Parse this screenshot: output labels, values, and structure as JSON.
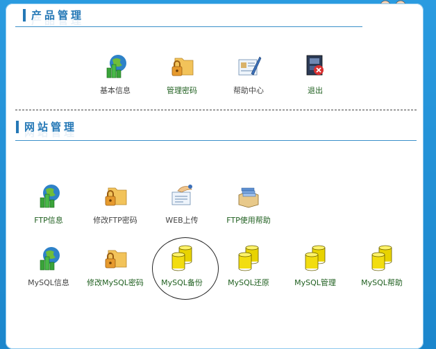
{
  "product_section": {
    "title": "产品管理",
    "items": [
      {
        "label": "基本信息",
        "icon": "globe-chart-icon",
        "style": "gray"
      },
      {
        "label": "管理密码",
        "icon": "folder-lock-icon",
        "style": "green"
      },
      {
        "label": "帮助中心",
        "icon": "help-card-icon",
        "style": "gray"
      },
      {
        "label": "退出",
        "icon": "logout-icon",
        "style": "green"
      }
    ]
  },
  "website_section": {
    "title": "网站管理",
    "row1": [
      {
        "label": "FTP信息",
        "icon": "globe-chart-icon",
        "style": "green"
      },
      {
        "label": "修改FTP密码",
        "icon": "folder-lock-icon",
        "style": "gray"
      },
      {
        "label": "WEB上传",
        "icon": "upload-icon",
        "style": "gray"
      },
      {
        "label": "FTP使用帮助",
        "icon": "box-icon",
        "style": "green"
      }
    ],
    "row2": [
      {
        "label": "MySQL信息",
        "icon": "globe-chart-icon",
        "style": "gray"
      },
      {
        "label": "修改MySQL密码",
        "icon": "folder-lock-icon",
        "style": "green"
      },
      {
        "label": "MySQL备份",
        "icon": "database-icon",
        "style": "green"
      },
      {
        "label": "MySQL还原",
        "icon": "database-icon",
        "style": "green"
      },
      {
        "label": "MySQL管理",
        "icon": "database-icon",
        "style": "green"
      },
      {
        "label": "MySQL帮助",
        "icon": "database-icon",
        "style": "green"
      }
    ]
  },
  "colors": {
    "background": "#1f8fd6",
    "title": "#2578b6",
    "label_green": "#1f5f1f",
    "label_gray": "#444444"
  }
}
